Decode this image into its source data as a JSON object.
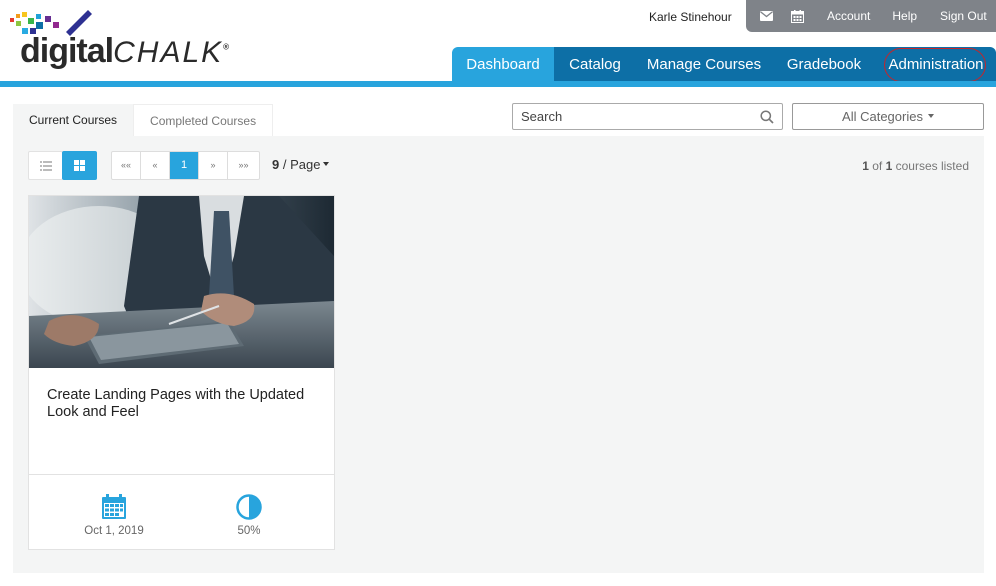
{
  "brand": {
    "logo_text_main": "digital",
    "logo_text_accent": "CHALK"
  },
  "user": {
    "name": "Karle Stinehour"
  },
  "utility": {
    "account": "Account",
    "help": "Help",
    "sign_out": "Sign Out",
    "mail_icon": "envelope-icon",
    "calendar_icon": "calendar-icon"
  },
  "nav": {
    "items": [
      {
        "label": "Dashboard",
        "active": true
      },
      {
        "label": "Catalog",
        "active": false
      },
      {
        "label": "Manage Courses",
        "active": false
      },
      {
        "label": "Gradebook",
        "active": false
      },
      {
        "label": "Administration",
        "active": false
      }
    ]
  },
  "tabs": [
    {
      "label": "Current Courses",
      "active": true
    },
    {
      "label": "Completed Courses",
      "active": false
    }
  ],
  "search": {
    "placeholder": "Search"
  },
  "category": {
    "selected": "All Categories"
  },
  "pagination": {
    "first": "««",
    "prev": "«",
    "current": "1",
    "next": "»",
    "last": "»»",
    "per_page_count": "9",
    "per_page_label": "/ Page"
  },
  "listing": {
    "shown": "1",
    "of_word": "of",
    "total": "1",
    "suffix": "courses listed"
  },
  "course": {
    "title": "Create Landing Pages with the Updated Look and Feel",
    "date": "Oct 1, 2019",
    "progress_label": "50%",
    "progress": 0.5
  },
  "colors": {
    "nav_dark": "#0d6fa6",
    "nav_active": "#28a4dd",
    "utility_bar": "#7f8389",
    "highlight_ring": "#c4262b",
    "accent": "#28a4dd"
  }
}
